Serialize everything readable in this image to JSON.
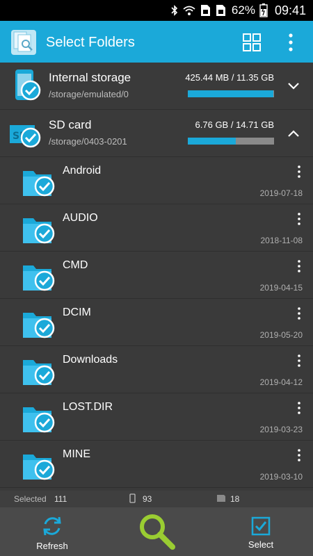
{
  "status_bar": {
    "battery": "62%",
    "time": "09:41",
    "icons": [
      "bluetooth-icon",
      "wifi-icon",
      "sim-icon",
      "sim2-icon",
      "battery-icon"
    ]
  },
  "app_bar": {
    "title": "Select Folders",
    "icons": [
      "app-logo-icon",
      "grid-view-icon",
      "overflow-menu-icon"
    ]
  },
  "storages": [
    {
      "name": "Internal storage",
      "path": "/storage/emulated/0",
      "size": "425.44 MB / 11.35 GB",
      "used_fraction": 0.99,
      "expanded": false,
      "icon": "phone-storage-icon"
    },
    {
      "name": "SD card",
      "path": "/storage/0403-0201",
      "size": "6.76 GB / 14.71 GB",
      "used_fraction": 0.56,
      "expanded": true,
      "icon": "sd-card-icon"
    }
  ],
  "folders": [
    {
      "name": "Android",
      "date": "2019-07-18"
    },
    {
      "name": "AUDIO",
      "date": "2018-11-08"
    },
    {
      "name": "CMD",
      "date": "2019-04-15"
    },
    {
      "name": "DCIM",
      "date": "2019-05-20"
    },
    {
      "name": "Downloads",
      "date": "2019-04-12"
    },
    {
      "name": "LOST.DIR",
      "date": "2019-03-23"
    },
    {
      "name": "MINE",
      "date": "2019-03-10"
    }
  ],
  "summary": {
    "selected_label": "Selected",
    "selected_count": "111",
    "internal_count": "93",
    "sd_count": "18"
  },
  "bottom_bar": {
    "refresh_label": "Refresh",
    "select_label": "Select"
  },
  "colors": {
    "accent": "#1ba9d9",
    "search": "#9acd32",
    "background": "#3a3a3a"
  }
}
